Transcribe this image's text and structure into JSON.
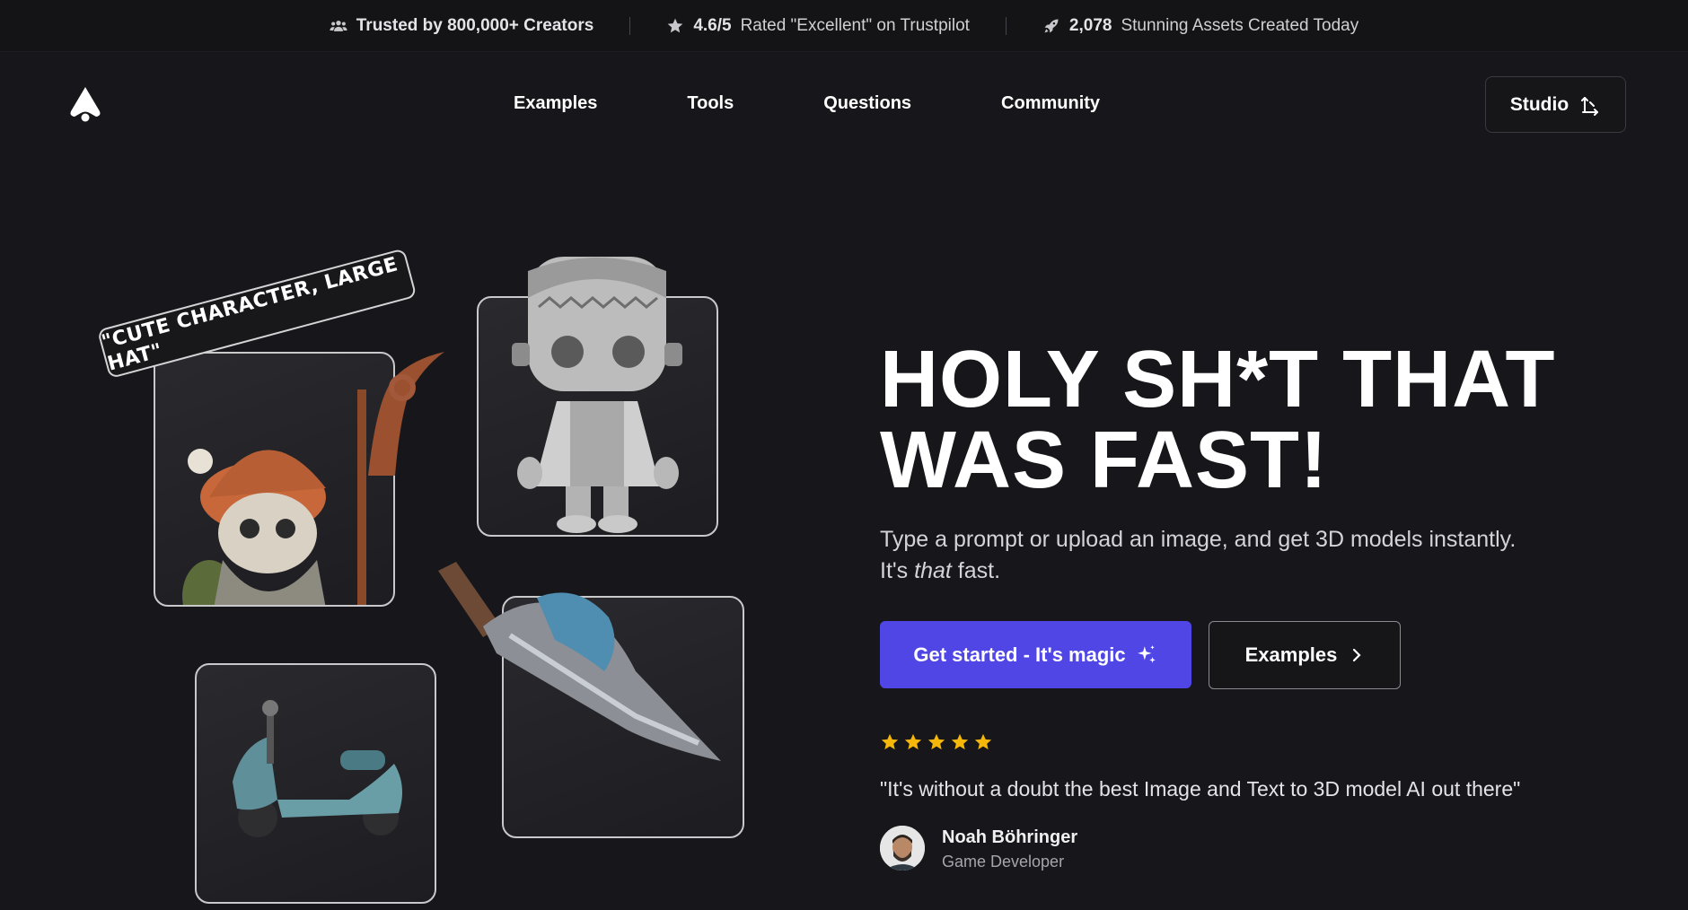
{
  "topbar": {
    "stat1": {
      "bold": "Trusted by 800,000+ Creators",
      "icon": "users-icon"
    },
    "stat2": {
      "bold": "4.6/5",
      "text": "Rated \"Excellent\" on Trustpilot",
      "icon": "star-icon"
    },
    "stat3": {
      "bold": "2,078",
      "text": "Stunning Assets Created Today",
      "icon": "rocket-icon"
    }
  },
  "nav": {
    "links": [
      "Examples",
      "Tools",
      "Questions",
      "Community"
    ],
    "studio_label": "Studio"
  },
  "hero": {
    "tag": "\"CUTE CHARACTER, LARGE HAT\"",
    "headline_line1": "HOLY SH*T THAT",
    "headline_line2": "WAS FAST!",
    "sub_line1": "Type a prompt or upload an image, and get 3D models instantly.",
    "sub_line2_pre": "It's ",
    "sub_line2_italic": "that",
    "sub_line2_post": " fast.",
    "primary_button": "Get started - It's magic",
    "secondary_button": "Examples",
    "rating_stars": 5,
    "quote": "\"It's without a doubt the best Image and Text to 3D model AI out there\"",
    "author_name": "Noah Böhringer",
    "author_role": "Game Developer"
  },
  "colors": {
    "background": "#17171b",
    "primary": "#4f46e5",
    "star": "#f5b70a"
  }
}
